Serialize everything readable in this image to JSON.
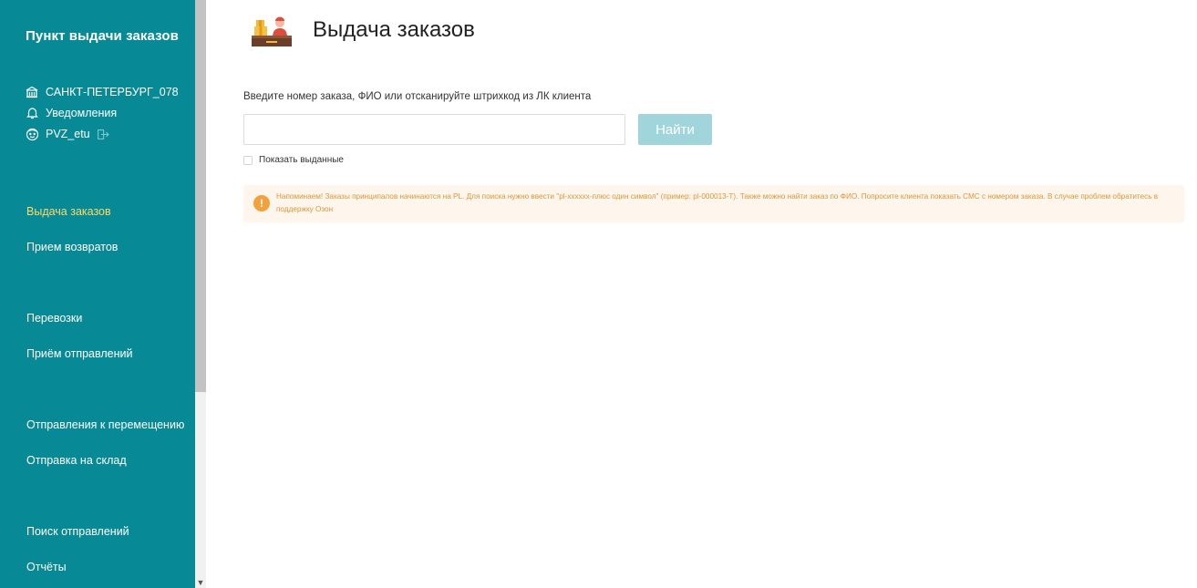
{
  "sidebar": {
    "brand": "Пункт выдачи заказов",
    "location": "САНКТ-ПЕТЕРБУРГ_078",
    "notifications": "Уведомления",
    "user": "PVZ_etu",
    "nav": [
      {
        "label": "Выдача заказов",
        "active": true
      },
      {
        "label": "Прием возвратов"
      },
      {
        "label": "Перевозки"
      },
      {
        "label": "Приём отправлений"
      },
      {
        "label": "Отправления к перемещению"
      },
      {
        "label": "Отправка на склад"
      },
      {
        "label": "Поиск отправлений"
      },
      {
        "label": "Отчёты"
      }
    ],
    "active_color": "#FFD965",
    "background": "#078A96"
  },
  "main": {
    "title": "Выдача заказов",
    "prompt": "Введите номер заказа, ФИО или отсканируйте штрихкод из ЛК клиента",
    "search_value": "",
    "find_label": "Найти",
    "show_issued_label": "Показать выданные",
    "notice": "Напоминаем! Заказы принципалов начинаются на PL. Для поиска нужно ввести \"pl-xxxxxx-плюс один символ\" (пример: pl-000013-T). Также можно найти заказ по ФИО. Попросите клиента показать СМС с номером заказа. В случае проблем обратитесь в поддержку Озон",
    "button_color": "#9FD5DB",
    "notice_color": "#E0963A"
  },
  "icons": {
    "location": "building-icon",
    "notifications": "bell-icon",
    "user": "user-face-icon",
    "logout": "logout-icon",
    "header": "parcel-desk-icon",
    "notice": "exclamation-icon"
  }
}
